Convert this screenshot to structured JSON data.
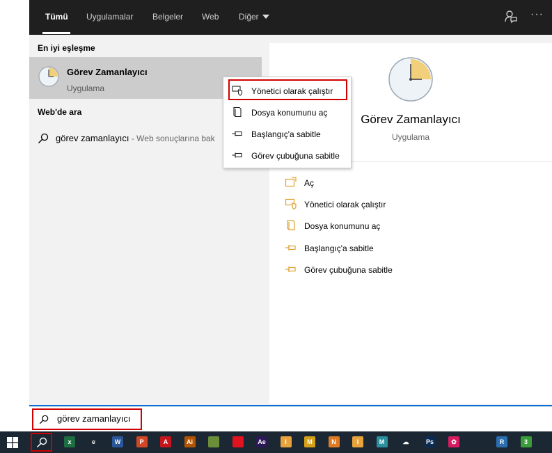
{
  "tabs": [
    {
      "label": "Tümü",
      "active": true
    },
    {
      "label": "Uygulamalar",
      "active": false
    },
    {
      "label": "Belgeler",
      "active": false
    },
    {
      "label": "Web",
      "active": false
    },
    {
      "label": "Diğer",
      "active": false
    }
  ],
  "left": {
    "best_match_title": "En iyi eşleşme",
    "best_match_name": "Görev Zamanlayıcı",
    "best_match_type": "Uygulama",
    "web_title": "Web'de ara",
    "web_query": "görev zamanlayıcı",
    "web_suffix": " - Web sonuçlarına bak"
  },
  "preview": {
    "title": "Görev Zamanlayıcı",
    "type": "Uygulama",
    "actions": [
      {
        "label": "Aç",
        "icon": "open-icon"
      },
      {
        "label": "Yönetici olarak çalıştır",
        "icon": "shield-icon"
      },
      {
        "label": "Dosya konumunu aç",
        "icon": "folder-icon"
      },
      {
        "label": "Başlangıç'a sabitle",
        "icon": "pin-icon"
      },
      {
        "label": "Görev çubuğuna sabitle",
        "icon": "pin-icon"
      }
    ]
  },
  "context_menu": {
    "items": [
      {
        "label": "Yönetici olarak çalıştır",
        "icon": "shield-icon"
      },
      {
        "label": "Dosya konumunu aç",
        "icon": "folder-icon"
      },
      {
        "label": "Başlangıç'a sabitle",
        "icon": "pin-icon"
      },
      {
        "label": "Görev çubuğuna sabitle",
        "icon": "pin-icon"
      }
    ]
  },
  "search": {
    "value": "görev zamanlayıcı"
  },
  "taskbar": {
    "apps": [
      {
        "name": "excel",
        "glyph": "x",
        "color": "#1d6f42"
      },
      {
        "name": "ie",
        "glyph": "e",
        "color": "#1b2733"
      },
      {
        "name": "word",
        "glyph": "W",
        "color": "#2b579a"
      },
      {
        "name": "powerpoint",
        "glyph": "P",
        "color": "#d24726"
      },
      {
        "name": "acrobat",
        "glyph": "A",
        "color": "#c4161c"
      },
      {
        "name": "illustrator",
        "glyph": "Ai",
        "color": "#b45400"
      },
      {
        "name": "minecraft",
        "glyph": "",
        "color": "#6b8e3a"
      },
      {
        "name": "opera",
        "glyph": "",
        "color": "#e0131f"
      },
      {
        "name": "after-effects",
        "glyph": "Ae",
        "color": "#2b1a55"
      },
      {
        "name": "app-i",
        "glyph": "I",
        "color": "#e8a33d"
      },
      {
        "name": "app-m",
        "glyph": "M",
        "color": "#d4a017"
      },
      {
        "name": "app-n",
        "glyph": "N",
        "color": "#e07b24"
      },
      {
        "name": "app-i2",
        "glyph": "I",
        "color": "#e8a33d"
      },
      {
        "name": "app-m2",
        "glyph": "M",
        "color": "#2c8f9e"
      },
      {
        "name": "onedrive",
        "glyph": "☁",
        "color": "#1b2733"
      },
      {
        "name": "photoshop",
        "glyph": "Ps",
        "color": "#0b2b52"
      },
      {
        "name": "app-flower",
        "glyph": "✿",
        "color": "#d81b60"
      },
      {
        "name": "chrome",
        "glyph": "",
        "color": "#1b2733"
      },
      {
        "name": "app-r",
        "glyph": "R",
        "color": "#2a6fb0"
      },
      {
        "name": "app-3",
        "glyph": "3",
        "color": "#3b9c3b"
      }
    ]
  }
}
